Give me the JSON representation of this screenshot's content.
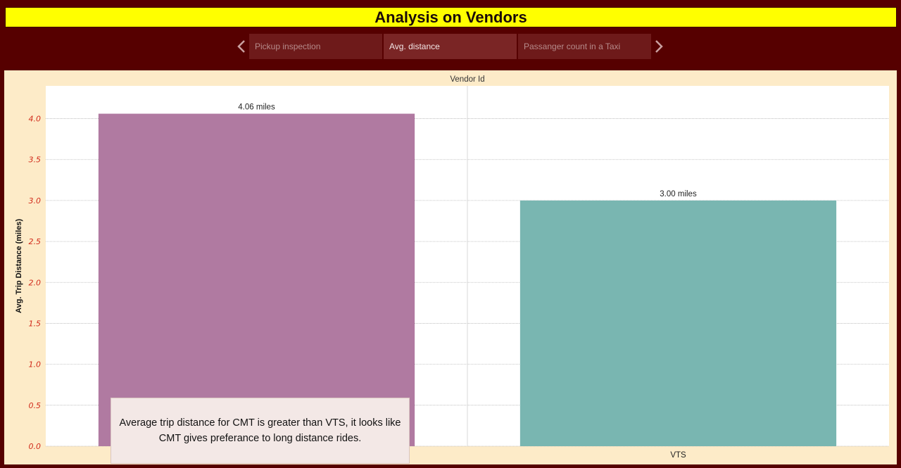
{
  "header": {
    "title": "Analysis on Vendors"
  },
  "tabs": [
    {
      "label": "Pickup inspection",
      "active": false
    },
    {
      "label": "Avg. distance",
      "active": true
    },
    {
      "label": "Passanger count in a Taxi",
      "active": false
    }
  ],
  "nav": {
    "prev_icon": "chevron-left-icon",
    "next_icon": "chevron-right-icon"
  },
  "chart_data": {
    "type": "bar",
    "title": "Vendor Id",
    "categories": [
      "CMT",
      "VTS"
    ],
    "values": [
      4.06,
      3.0
    ],
    "data_labels": [
      "4.06 miles",
      "3.00 miles"
    ],
    "bar_colors": [
      "#b07aa1",
      "#79b6b1"
    ],
    "xlabel": "",
    "ylabel": "Avg. Trip Distance (miles)",
    "ylim": [
      0,
      4.4
    ],
    "yticks": [
      "0.0",
      "0.5",
      "1.0",
      "1.5",
      "2.0",
      "2.5",
      "3.0",
      "3.5",
      "4.0"
    ],
    "grid": true
  },
  "annotation": {
    "text": "Average trip distance for CMT is greater than VTS, it looks like CMT gives preferance to long distance rides."
  },
  "colors": {
    "background": "#560000",
    "title_bg": "#ffff00",
    "panel_bg": "#fdebc8",
    "tick_color": "#d12a1a"
  }
}
